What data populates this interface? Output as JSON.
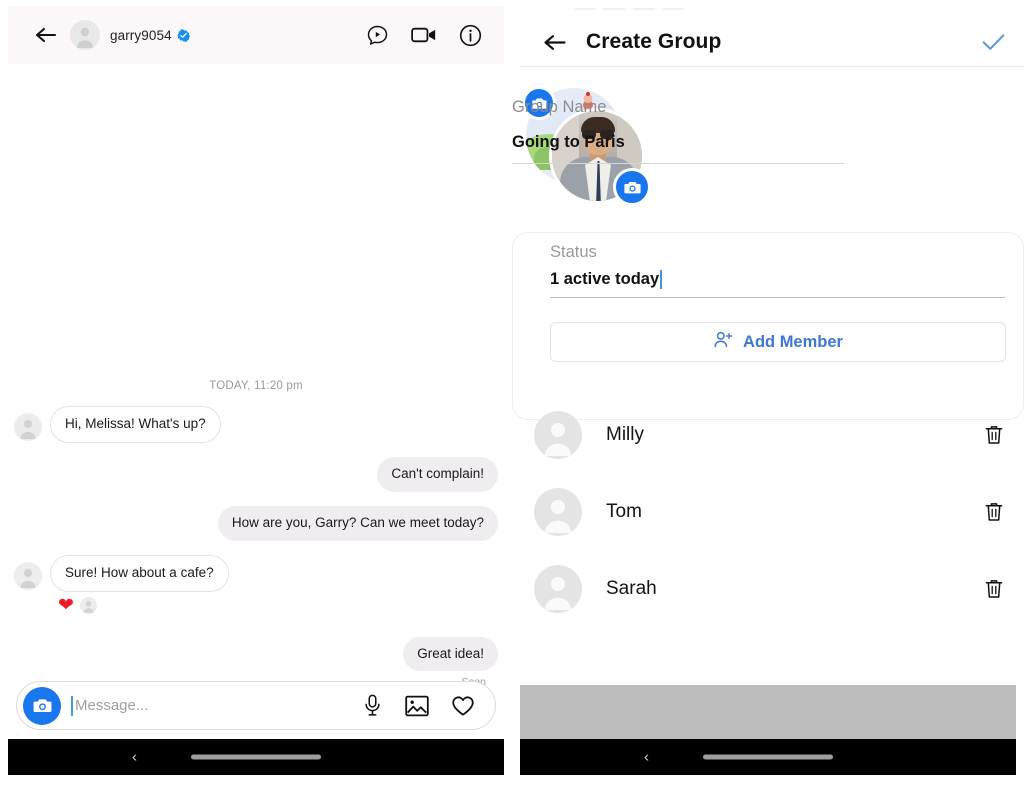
{
  "colors": {
    "accent_blue": "#1976ec",
    "link_blue": "#3d78d8",
    "check_blue": "#5a9bd8",
    "heart_red": "#ef1b24",
    "bubble_out": "#efedef",
    "header_tint": "#fcf8fa",
    "navbar_black": "#000000",
    "gray_strip": "#bdbdbd"
  },
  "chat": {
    "header": {
      "back_icon": "arrow-left-icon",
      "avatar": "user-avatar",
      "username": "garry9054",
      "verified_icon": "verified-badge-icon",
      "icons": [
        {
          "name": "video-message-icon",
          "label": "Video message"
        },
        {
          "name": "video-call-icon",
          "label": "Video call"
        },
        {
          "name": "info-icon",
          "label": "Info"
        }
      ]
    },
    "day_stamp": "TODAY, 11:20 pm",
    "messages": [
      {
        "id": "m1",
        "direction": "in",
        "text": "Hi, Melissa! What's up?"
      },
      {
        "id": "m2",
        "direction": "out",
        "text": "Can't complain!"
      },
      {
        "id": "m3",
        "direction": "out",
        "text": "How are you, Garry? Can we meet today?"
      },
      {
        "id": "m4",
        "direction": "in",
        "text": "Sure! How about a cafe?"
      },
      {
        "id": "m5",
        "direction": "out",
        "text": "Great idea!"
      }
    ],
    "reaction": {
      "emoji": "❤",
      "name": "heart-reaction"
    },
    "seen_label": "Seen",
    "composer": {
      "camera_icon": "camera-icon",
      "placeholder": "Message...",
      "value": "",
      "icons": [
        {
          "name": "microphone-icon",
          "label": "Voice"
        },
        {
          "name": "gallery-icon",
          "label": "Gallery"
        },
        {
          "name": "heart-icon",
          "label": "Like"
        }
      ]
    }
  },
  "create_group": {
    "header": {
      "back_icon": "arrow-left-icon",
      "title": "Create Group",
      "confirm_icon": "check-icon"
    },
    "avatar": {
      "back_avatar": "group-photo-back",
      "front_avatar": "group-photo-front",
      "camera_badge_top": "camera-badge-icon",
      "camera_badge_bottom": "camera-badge-icon"
    },
    "group_name": {
      "label": "Group Name",
      "value": "Going to Paris"
    },
    "status": {
      "label": "Status",
      "value": "1 active today"
    },
    "add_member": {
      "icon": "add-person-icon",
      "label": "Add Member"
    },
    "members": [
      {
        "id": "milly",
        "name": "Milly",
        "avatar": "user-avatar",
        "delete_icon": "trash-icon"
      },
      {
        "id": "tom",
        "name": "Tom",
        "avatar": "user-avatar",
        "delete_icon": "trash-icon"
      },
      {
        "id": "sarah",
        "name": "Sarah",
        "avatar": "user-avatar",
        "delete_icon": "trash-icon"
      }
    ]
  },
  "system_nav": {
    "back_glyph": "‹",
    "home_pill": "home-indicator"
  }
}
